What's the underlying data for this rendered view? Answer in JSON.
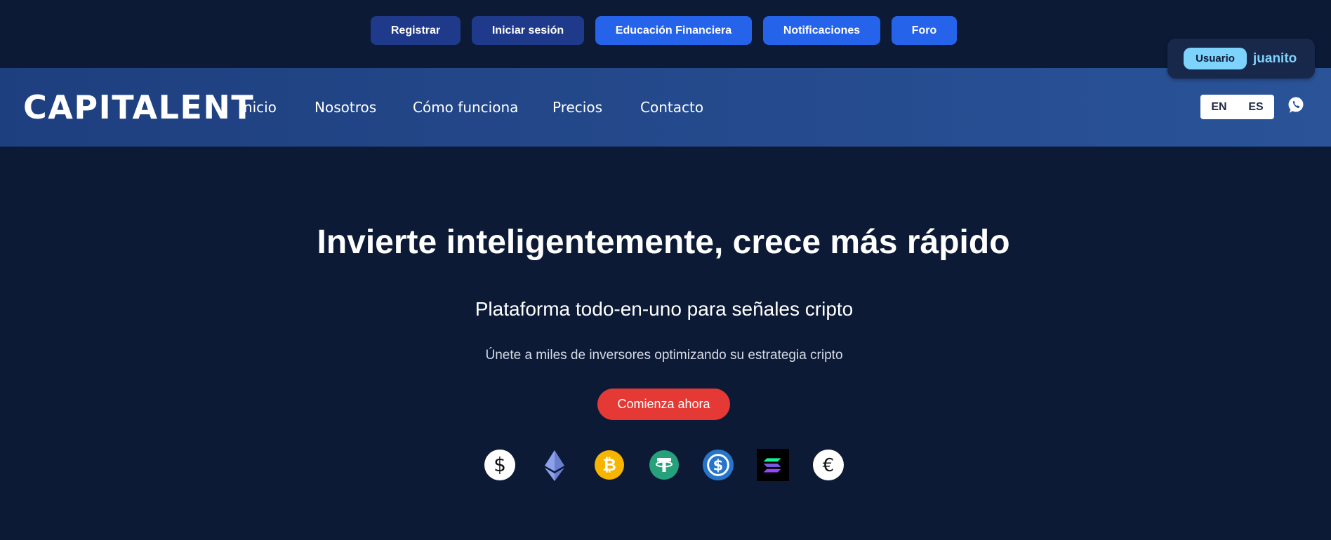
{
  "topbar": {
    "register": "Registrar",
    "login": "Iniciar sesión",
    "education": "Educación Financiera",
    "notifications": "Notificaciones",
    "forum": "Foro"
  },
  "user": {
    "badge": "Usuario",
    "name": "juanito"
  },
  "header": {
    "brand": "CAPITALENT",
    "nav": [
      "Inicio",
      "Nosotros",
      "Cómo funciona",
      "Precios",
      "Contacto"
    ],
    "lang_en": "EN",
    "lang_es": "ES"
  },
  "hero": {
    "title": "Invierte inteligentemente, crece más rápido",
    "subtitle": "Plataforma todo-en-uno para señales cripto",
    "description": "Únete a miles de inversores optimizando su estrategia cripto",
    "cta": "Comienza ahora"
  },
  "coins": [
    "dollar-icon",
    "ethereum-icon",
    "bitcoin-icon",
    "tether-icon",
    "usdc-icon",
    "solana-icon",
    "euro-icon"
  ],
  "colors": {
    "background": "#0c1a36",
    "nav_gradient_start": "#1e3f7f",
    "nav_gradient_end": "#2a5398",
    "button_dark": "#1f3a8a",
    "button_blue": "#2563eb",
    "cta_red": "#e53935",
    "user_accent": "#7dd3fc"
  }
}
